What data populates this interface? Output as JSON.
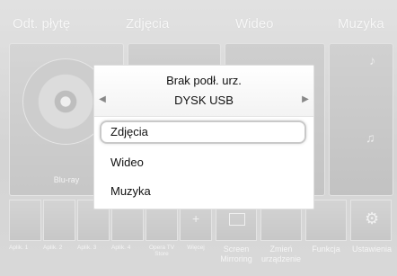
{
  "categories": {
    "disc": "Odt. płytę",
    "photos": "Zdjęcia",
    "video": "Wideo",
    "music": "Muzyka"
  },
  "disc_panel": {
    "label": "Blu-ray"
  },
  "apps": [
    {
      "label": "Aplik. 1"
    },
    {
      "label": "Aplik. 2"
    },
    {
      "label": "Aplik. 3"
    },
    {
      "label": "Aplik. 4"
    },
    {
      "label": "Opera TV Store"
    },
    {
      "label": "Więcej"
    },
    {
      "label": "Screen Mirroring"
    },
    {
      "label": "Zmień urządzenie"
    },
    {
      "label": "Funkcja"
    },
    {
      "label": "Ustawienia"
    }
  ],
  "dialog": {
    "title": "Brak podł. urz.",
    "device": "DYSK USB",
    "items": [
      {
        "label": "Zdjęcia",
        "selected": true
      },
      {
        "label": "Wideo",
        "selected": false
      },
      {
        "label": "Muzyka",
        "selected": false
      }
    ]
  },
  "colors": {
    "background": "#c8c8c8",
    "dialog_bg": "#ffffff",
    "selection_border": "#c9c9c9",
    "category_text": "#f4f4f4"
  },
  "icons": [
    "left-arrow-icon",
    "right-arrow-icon",
    "disc-icon",
    "music-note-icon",
    "settings-gear-icon",
    "screen-mirroring-icon",
    "add-icon"
  ]
}
